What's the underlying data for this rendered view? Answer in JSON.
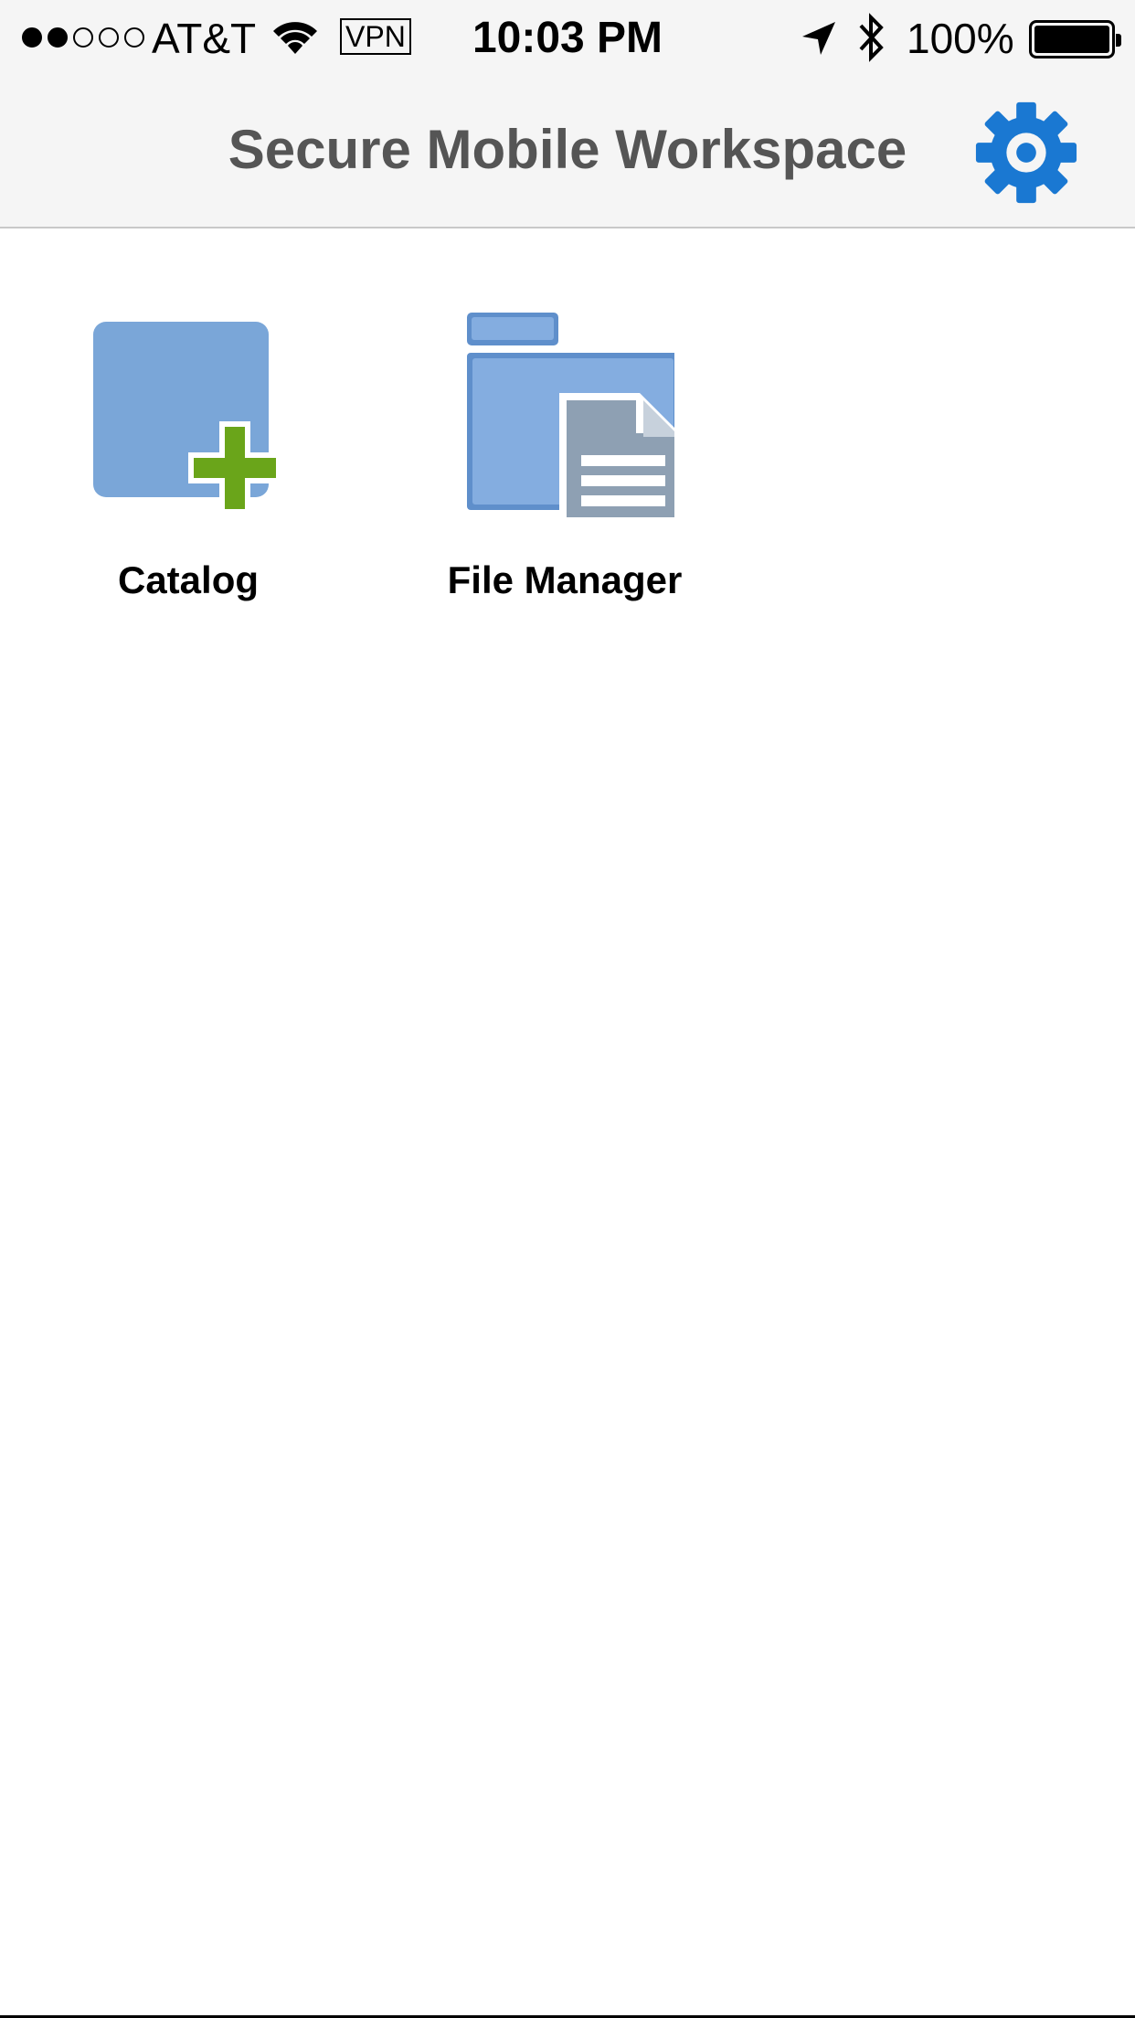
{
  "status_bar": {
    "signal_bars_filled": 2,
    "signal_bars_total": 5,
    "carrier": "AT&T",
    "vpn": "VPN",
    "time": "10:03 PM",
    "battery_percent": "100%",
    "icons": [
      "wifi-icon",
      "location-arrow-icon",
      "bluetooth-icon",
      "battery-icon"
    ]
  },
  "nav": {
    "title": "Secure Mobile Workspace",
    "settings_icon": "gear-icon"
  },
  "apps": [
    {
      "label": "Catalog",
      "icon": "catalog-plus-icon"
    },
    {
      "label": "File Manager",
      "icon": "folder-document-icon"
    }
  ],
  "colors": {
    "accent": "#1a78d2",
    "tile_blue": "#7aa6d8",
    "plus_green": "#6aa51a",
    "doc_gray": "#8ea0b3",
    "title_gray": "#555555"
  }
}
